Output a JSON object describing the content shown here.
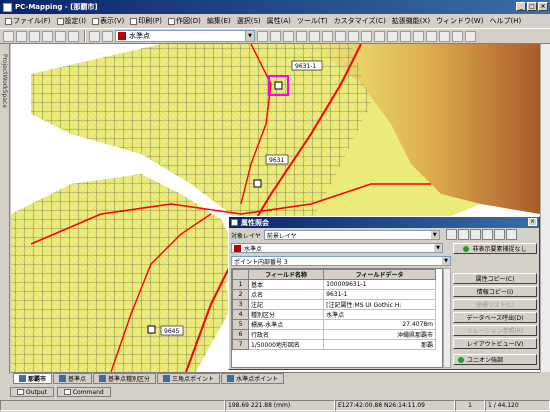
{
  "window": {
    "title": "PC-Mapping - [那覇市]",
    "buttons": [
      "_",
      "□",
      "×"
    ]
  },
  "menu": [
    {
      "label": "ファイル(F)"
    },
    {
      "label": "設定(I)"
    },
    {
      "label": "表示(V)"
    },
    {
      "label": "印刷(P)"
    },
    {
      "label": "作図(D)"
    },
    {
      "label": "編集(E)"
    },
    {
      "label": "選択(S)"
    },
    {
      "label": "属性(A)"
    },
    {
      "label": "ツール(T)"
    },
    {
      "label": "カスタマイズ(C)"
    },
    {
      "label": "拡張機能(X)"
    },
    {
      "label": "ウィンドウ(W)"
    },
    {
      "label": "ヘルプ(H)"
    }
  ],
  "toolbar": {
    "layer_select": "水準点"
  },
  "sidebar": {
    "label": "ProjectWorkSpace"
  },
  "map": {
    "labels": [
      {
        "text": "9631-1"
      },
      {
        "text": "9631"
      },
      {
        "text": "9645"
      }
    ],
    "colors": {
      "land": "#ebeb7a",
      "road": "#ff0000",
      "street": "#8a8a5c",
      "highlight": "#ff00ff"
    }
  },
  "dialog": {
    "title": "属性照会",
    "target_layer_label": "対象レイヤ",
    "target_layer_value": "前景レイヤ",
    "layer_value": "水準点",
    "hide_button": "非表示要素捕捉なし",
    "point_label": "ポイント内部番号 3",
    "table": {
      "headers": [
        "フィールド名称",
        "フィールドデータ"
      ],
      "rows": [
        {
          "num": "1",
          "name": "基本",
          "value": "100009631-1"
        },
        {
          "num": "2",
          "name": "点名",
          "value": "9631-1"
        },
        {
          "num": "3",
          "name": "注記",
          "value": "[注記属性:MS UI Gothic H:"
        },
        {
          "num": "4",
          "name": "種別区分",
          "value": "水準点"
        },
        {
          "num": "5",
          "name": "標高-水準点",
          "value": "27.4078m"
        },
        {
          "num": "6",
          "name": "行政名",
          "value": "沖縄県那覇市"
        },
        {
          "num": "7",
          "name": "1/50000地形図名",
          "value": "那覇"
        }
      ]
    },
    "buttons": [
      {
        "label": "属性コピー(C)",
        "enabled": true
      },
      {
        "label": "情報コピー(I)",
        "enabled": true
      },
      {
        "label": "座標リスト(L)",
        "enabled": false
      },
      {
        "label": "データベース呼出(D)",
        "enabled": true
      },
      {
        "label": "リレーション参照(R)",
        "enabled": false
      },
      {
        "label": "レイアウトビュー(V)",
        "enabled": true
      },
      {
        "label": "ユニオン強調",
        "enabled": true
      }
    ]
  },
  "sheet_tabs": [
    {
      "label": "那覇市",
      "active": true
    },
    {
      "label": "基準点",
      "active": false
    },
    {
      "label": "基準点種別区分",
      "active": false
    },
    {
      "label": "三角点ポイント",
      "active": false
    },
    {
      "label": "水準点ポイント",
      "active": false
    }
  ],
  "output_tabs": [
    {
      "label": "Output"
    },
    {
      "label": "Command"
    }
  ],
  "status": {
    "coords": "198.69 221.88 (mm)",
    "latlon": "E127:42:00.88 N26:14:11.09",
    "page": "1",
    "scale": "1 / 44,120"
  }
}
